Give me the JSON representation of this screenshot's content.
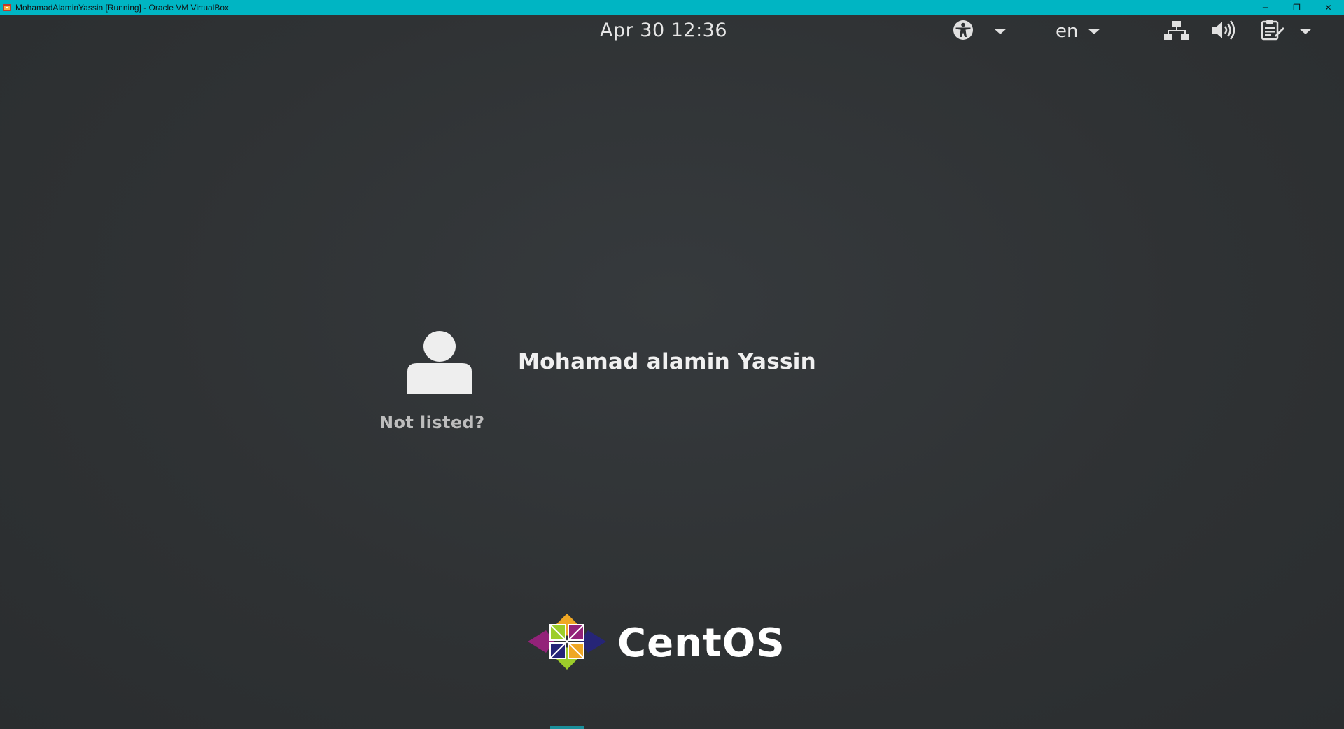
{
  "window": {
    "title": "MohamadAlaminYassin [Running] - Oracle VM VirtualBox",
    "controls": {
      "minimize": "─",
      "restore": "❐",
      "close": "✕"
    }
  },
  "topbar": {
    "clock": "Apr 30  12:36",
    "language": "en",
    "icons": [
      "accessibility-icon",
      "network-icon",
      "volume-icon",
      "power-menu-icon"
    ]
  },
  "login": {
    "user_name": "Mohamad alamin Yassin",
    "not_listed": "Not listed?"
  },
  "branding": {
    "logo_text": "CentOS"
  },
  "colors": {
    "titlebar": "#00b5c3",
    "background": "#2e3133",
    "text": "#f0f0f0",
    "accent": "#1b8f9b"
  }
}
